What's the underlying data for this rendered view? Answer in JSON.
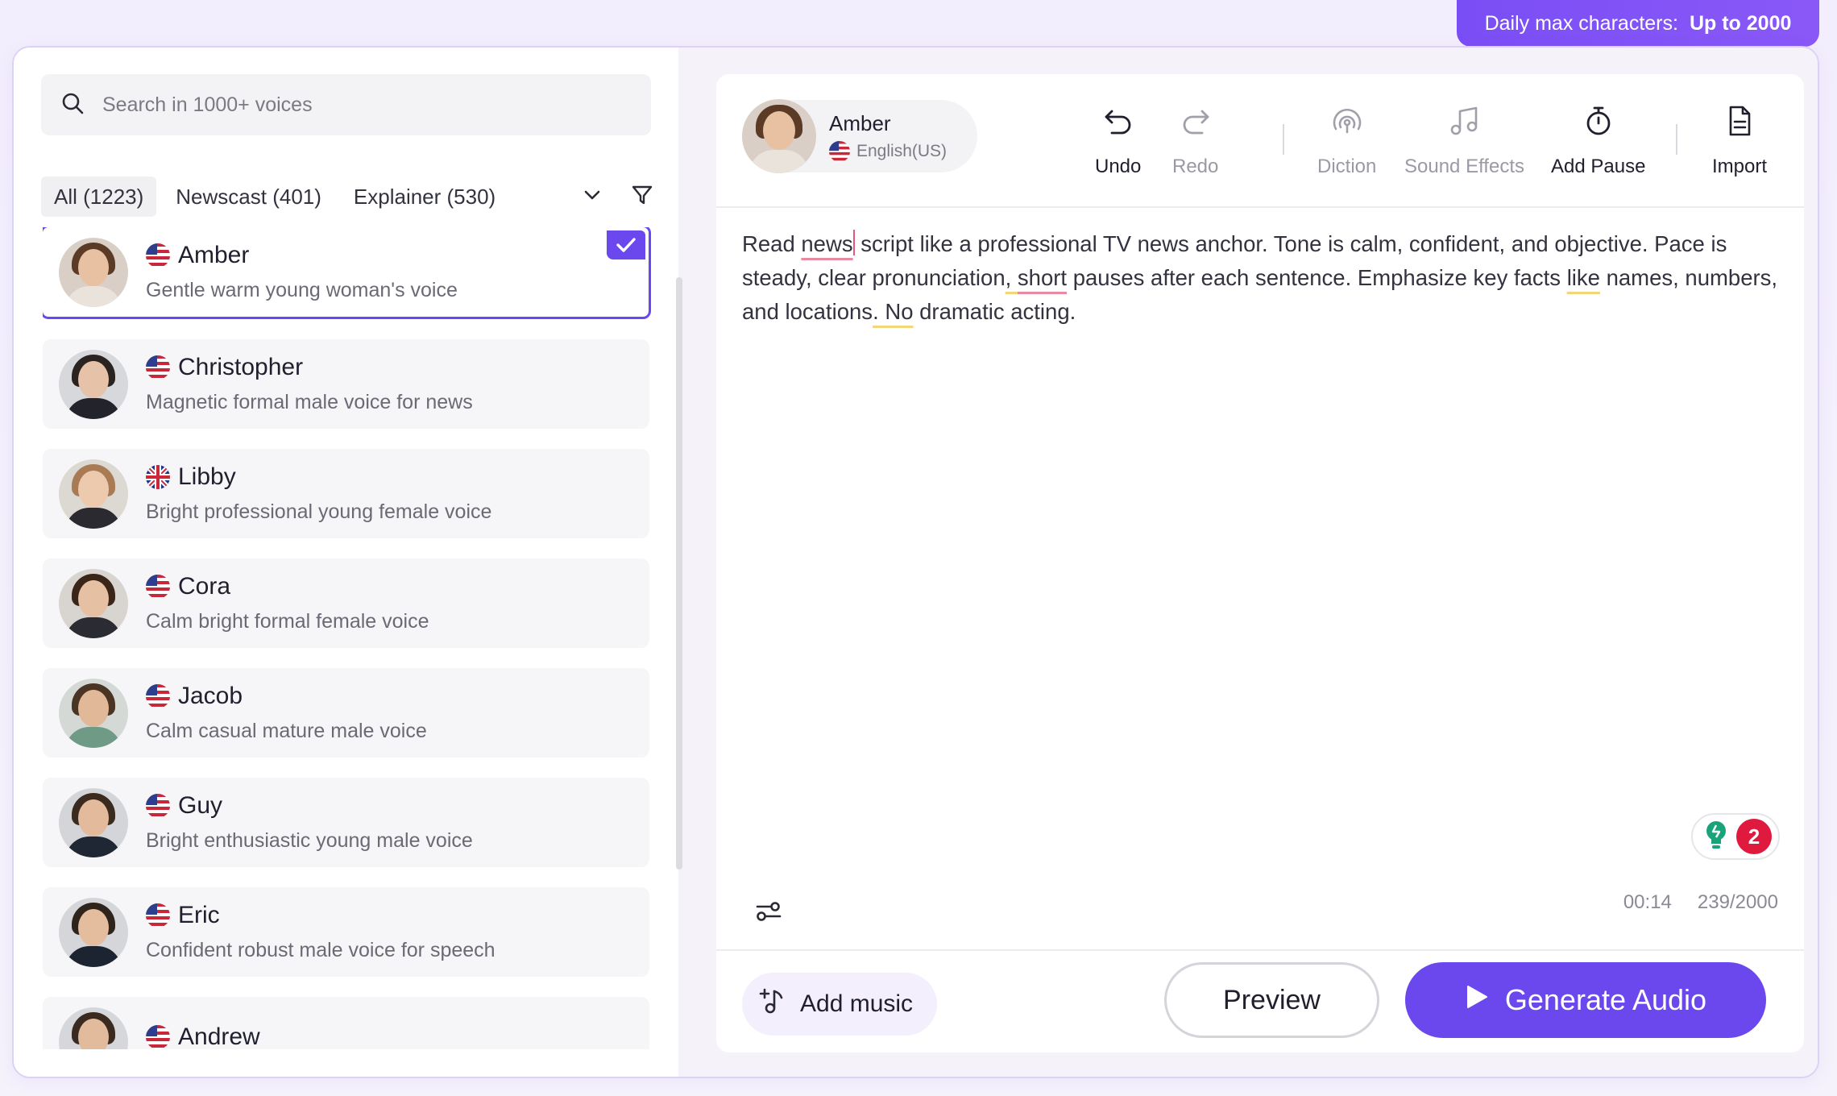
{
  "banner": {
    "label": "Daily max characters:",
    "value": "Up to 2000"
  },
  "search": {
    "placeholder": "Search in 1000+ voices"
  },
  "tabs": [
    {
      "label": "All (1223)"
    },
    {
      "label": "Newscast (401)"
    },
    {
      "label": "Explainer (530)"
    }
  ],
  "voices": [
    {
      "name": "Amber",
      "desc": "Gentle warm young woman's voice",
      "flag": "us-flag-icon"
    },
    {
      "name": "Christopher",
      "desc": "Magnetic formal male voice for news",
      "flag": "us-flag-icon"
    },
    {
      "name": "Libby",
      "desc": "Bright professional young female voice",
      "flag": "uk-flag-icon"
    },
    {
      "name": "Cora",
      "desc": "Calm bright formal female voice",
      "flag": "us-flag-icon"
    },
    {
      "name": "Jacob",
      "desc": "Calm casual mature male voice",
      "flag": "us-flag-icon"
    },
    {
      "name": "Guy",
      "desc": "Bright enthusiastic young male voice",
      "flag": "us-flag-icon"
    },
    {
      "name": "Eric",
      "desc": "Confident robust male voice for speech",
      "flag": "us-flag-icon"
    },
    {
      "name": "Andrew",
      "desc": "",
      "flag": "us-flag-icon"
    }
  ],
  "current_voice": {
    "name": "Amber",
    "language": "English(US)"
  },
  "toolbar": {
    "undo": "Undo",
    "redo": "Redo",
    "diction": "Diction",
    "sound_effects": "Sound Effects",
    "add_pause": "Add Pause",
    "import": "Import"
  },
  "editor": {
    "t1": "Read ",
    "w1": "news",
    "t2": " script like a professional TV news anchor. Tone is calm, confident, and objective. Pace is steady, clear pronunciation",
    "w2": ", ",
    "w3": "short",
    "t3": " pauses after each sentence. Emphasize key facts ",
    "w4": "like",
    "t4": " names, numbers, and locations",
    "w5": ". No",
    "t5": " dramatic acting."
  },
  "hints": {
    "count": "2"
  },
  "meta": {
    "duration": "00:14",
    "chars": "239/2000"
  },
  "footer": {
    "add_music": "Add music",
    "preview": "Preview",
    "generate": "Generate Audio"
  },
  "colors": {
    "accent": "#6b47ee",
    "banner": "#7a4ef5",
    "hint_badge": "#e0193f",
    "hint_icon": "#19a37a"
  }
}
